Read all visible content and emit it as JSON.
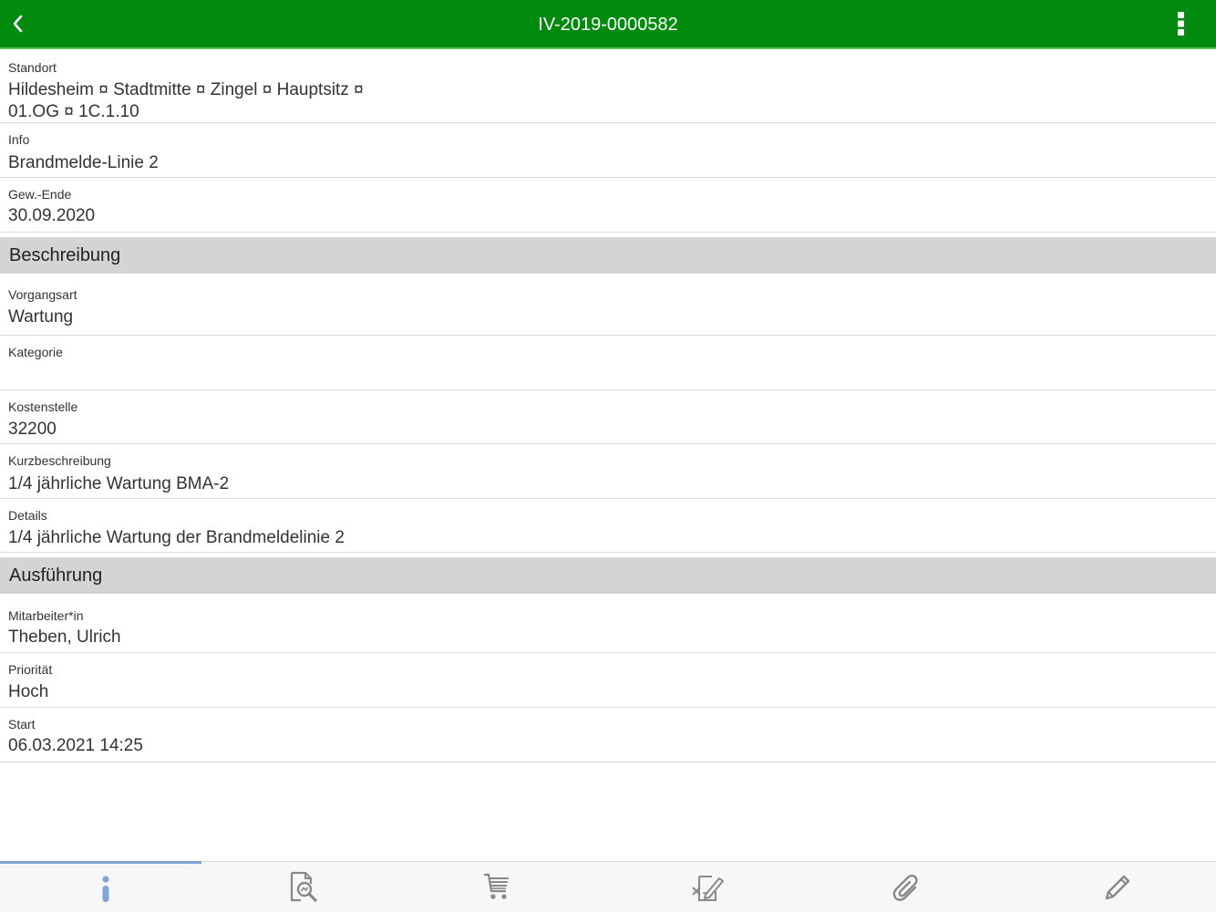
{
  "header": {
    "title": "IV-2019-0000582"
  },
  "fields_top": [
    {
      "label": "Standort",
      "value_line1": "Hildesheim ¤ Stadtmitte ¤ Zingel ¤ Hauptsitz ¤",
      "value_line2": "01.OG ¤ 1C.1.10"
    },
    {
      "label": "Info",
      "value": "Brandmelde-Linie 2"
    },
    {
      "label": "Gew.-Ende",
      "value": "30.09.2020"
    }
  ],
  "sections": {
    "beschreibung": "Beschreibung",
    "ausfuehrung": "Ausführung"
  },
  "fields_beschreibung": [
    {
      "label": "Vorgangsart",
      "value": "Wartung"
    },
    {
      "label": "Kategorie",
      "value": ""
    },
    {
      "label": "Kostenstelle",
      "value": "32200"
    },
    {
      "label": "Kurzbeschreibung",
      "value": "1/4 jährliche Wartung BMA-2"
    },
    {
      "label": "Details",
      "value": "1/4 jährliche Wartung der Brandmeldelinie 2"
    }
  ],
  "fields_ausfuehrung": [
    {
      "label": "Mitarbeiter*in",
      "value": "Theben, Ulrich"
    },
    {
      "label": "Priorität",
      "value": "Hoch"
    },
    {
      "label": "Start",
      "value": "06.03.2021 14:25"
    }
  ],
  "tabbar": {
    "active_tab": "info",
    "icons": [
      "info-icon",
      "document-search-icon",
      "cart-icon",
      "checklist-edit-icon",
      "paperclip-icon",
      "pencil-icon"
    ]
  },
  "colors": {
    "header": "#008a0e",
    "section": "#d3d4d6",
    "tab_accent": "#7fa6d4",
    "tab_icon": "#888888"
  }
}
